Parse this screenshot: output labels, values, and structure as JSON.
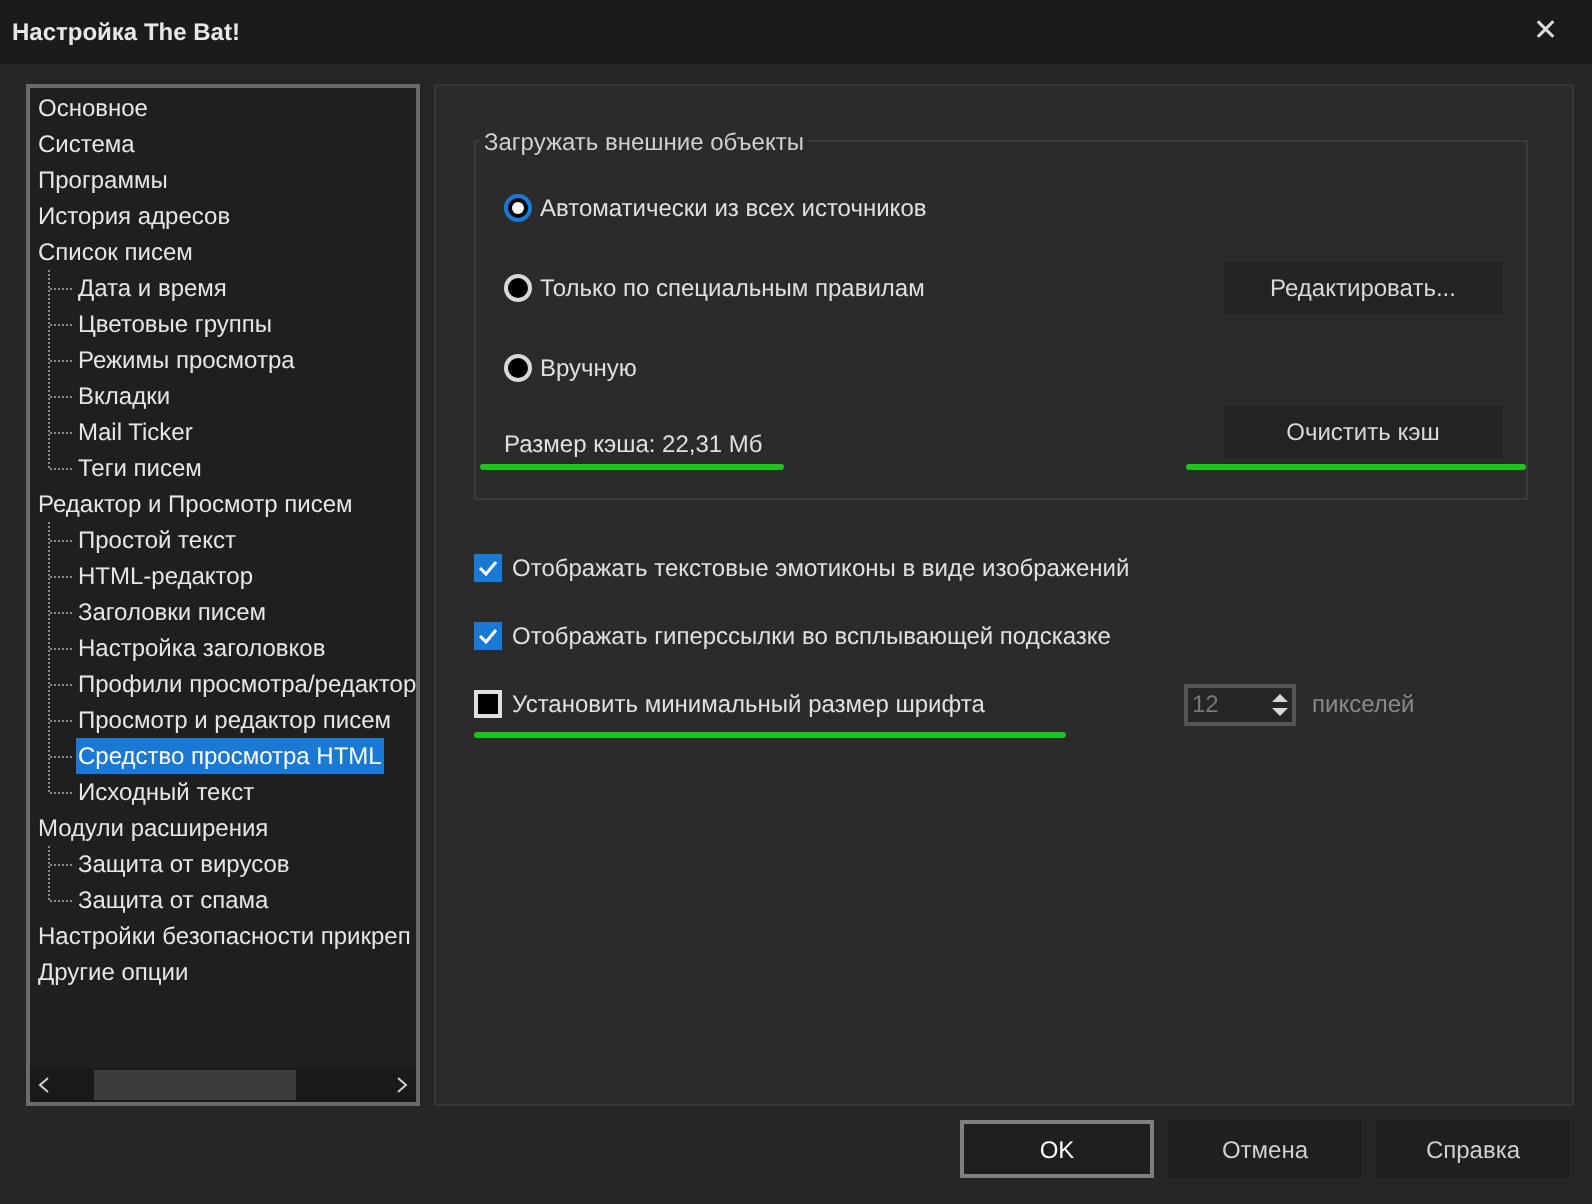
{
  "window": {
    "title": "Настройка The Bat!",
    "close": "✕"
  },
  "tree": {
    "items": [
      {
        "label": "Основное",
        "selected": false
      },
      {
        "label": "Система",
        "selected": false
      },
      {
        "label": "Программы",
        "selected": false
      },
      {
        "label": "История адресов",
        "selected": false
      },
      {
        "label": "Список писем",
        "selected": false,
        "children": [
          {
            "label": "Дата и время",
            "selected": false
          },
          {
            "label": "Цветовые группы",
            "selected": false
          },
          {
            "label": "Режимы просмотра",
            "selected": false
          },
          {
            "label": "Вкладки",
            "selected": false
          },
          {
            "label": "Mail Ticker",
            "selected": false
          },
          {
            "label": "Теги писем",
            "selected": false
          }
        ]
      },
      {
        "label": "Редактор и Просмотр писем",
        "selected": false,
        "children": [
          {
            "label": "Простой текст",
            "selected": false
          },
          {
            "label": "HTML-редактор",
            "selected": false
          },
          {
            "label": "Заголовки писем",
            "selected": false
          },
          {
            "label": "Настройка заголовков",
            "selected": false
          },
          {
            "label": "Профили просмотра/редактор",
            "selected": false
          },
          {
            "label": "Просмотр и редактор писем",
            "selected": false
          },
          {
            "label": "Средство просмотра HTML",
            "selected": true
          },
          {
            "label": "Исходный текст",
            "selected": false
          }
        ]
      },
      {
        "label": "Модули расширения",
        "selected": false,
        "children": [
          {
            "label": "Защита от вирусов",
            "selected": false
          },
          {
            "label": "Защита от спама",
            "selected": false
          }
        ]
      },
      {
        "label": "Настройки безопасности прикреп",
        "selected": false
      },
      {
        "label": "Другие опции",
        "selected": false
      }
    ]
  },
  "group": {
    "title": "Загружать внешние объекты",
    "radios": [
      {
        "label": "Автоматически из всех источников",
        "selected": true
      },
      {
        "label": "Только по специальным правилам",
        "selected": false,
        "button": "Редактировать..."
      },
      {
        "label": "Вручную",
        "selected": false
      }
    ],
    "cache_label": {
      "text": "Размер кэша: 22,31 Мб",
      "underlined": true
    },
    "clear_button": {
      "label": "Очистить кэш",
      "underlined": true
    }
  },
  "checkboxes": [
    {
      "label": "Отображать текстовые эмотиконы в виде изображений",
      "checked": true,
      "underlined": false
    },
    {
      "label": "Отображать гиперссылки во всплывающей подсказке",
      "checked": true,
      "underlined": false
    },
    {
      "label": "Установить минимальный размер шрифта",
      "checked": false,
      "underlined": true,
      "spin": {
        "value": "12",
        "disabled": true,
        "unit": "пикселей"
      }
    }
  ],
  "buttons": [
    {
      "label": "OK",
      "default": true
    },
    {
      "label": "Отмена",
      "default": false
    },
    {
      "label": "Справка",
      "default": false
    }
  ]
}
